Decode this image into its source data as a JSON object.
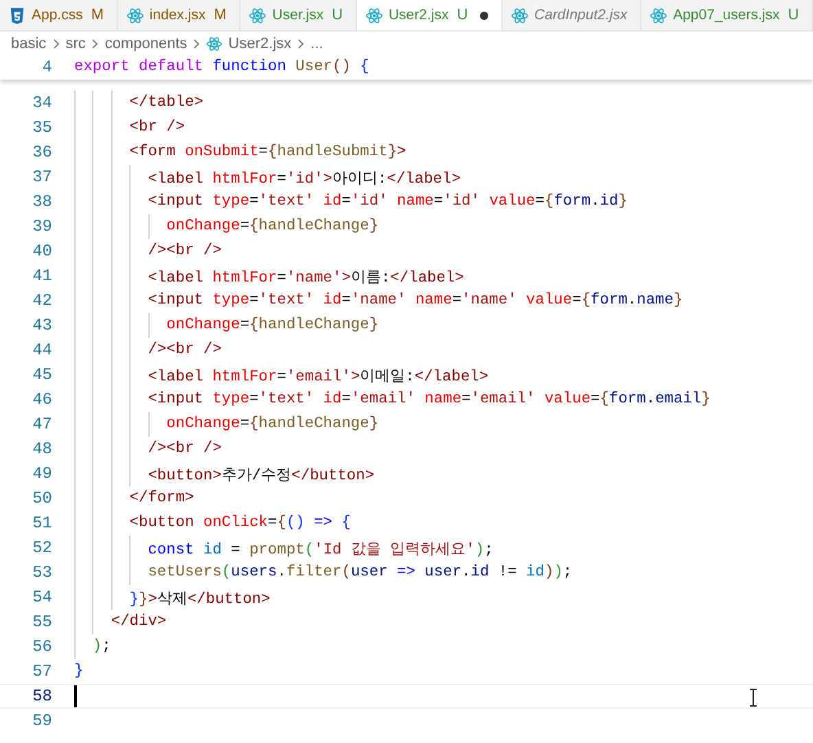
{
  "tabs": [
    {
      "label": "App.css",
      "kind": "css",
      "color": "#895503",
      "badge": "M",
      "selected": false,
      "dirty": false,
      "preview": false
    },
    {
      "label": "index.jsx",
      "kind": "react",
      "color": "#895503",
      "badge": "M",
      "selected": false,
      "dirty": false,
      "preview": false
    },
    {
      "label": "User.jsx",
      "kind": "react",
      "color": "#388a34",
      "badge": "U",
      "selected": false,
      "dirty": false,
      "preview": false
    },
    {
      "label": "User2.jsx",
      "kind": "react",
      "color": "#388a34",
      "badge": "U",
      "selected": true,
      "dirty": true,
      "preview": false
    },
    {
      "label": "CardInput2.jsx",
      "kind": "react",
      "color": "#777777",
      "selected": false,
      "dirty": false,
      "preview": true
    },
    {
      "label": "App07_users.jsx",
      "kind": "react",
      "color": "#388a34",
      "badge": "U",
      "selected": false,
      "dirty": false,
      "preview": false
    }
  ],
  "breadcrumb": [
    {
      "label": "basic",
      "kind": "folder"
    },
    {
      "label": "src",
      "kind": "folder"
    },
    {
      "label": "components",
      "kind": "folder"
    },
    {
      "label": "User2.jsx",
      "kind": "react"
    },
    {
      "label": "...",
      "kind": "more"
    }
  ],
  "sticky_line": {
    "number": "4",
    "tokens": [
      {
        "kind": "kw",
        "text": "export default "
      },
      {
        "kind": "kw2",
        "text": "function "
      },
      {
        "kind": "fn",
        "text": "User"
      },
      {
        "kind": "b3",
        "text": "() "
      },
      {
        "kind": "b1",
        "text": "{"
      }
    ]
  },
  "lines": [
    {
      "number": "34",
      "current": false,
      "tokens": [
        {
          "kind": "tag",
          "text": "      </table>"
        }
      ]
    },
    {
      "number": "35",
      "current": false,
      "tokens": [
        {
          "kind": "tag",
          "text": "      <br />"
        }
      ]
    },
    {
      "number": "36",
      "current": false,
      "tokens": [
        {
          "kind": "tag",
          "text": "      <form "
        },
        {
          "kind": "attr",
          "text": "onSubmit"
        },
        {
          "kind": "p",
          "text": "="
        },
        {
          "kind": "b3",
          "text": "{"
        },
        {
          "kind": "fn",
          "text": "handleSubmit"
        },
        {
          "kind": "b3",
          "text": "}"
        },
        {
          "kind": "tag",
          "text": ">"
        }
      ]
    },
    {
      "number": "37",
      "current": false,
      "tokens": [
        {
          "kind": "tag",
          "text": "        <label "
        },
        {
          "kind": "attr",
          "text": "htmlFor"
        },
        {
          "kind": "p",
          "text": "="
        },
        {
          "kind": "str",
          "text": "'id'"
        },
        {
          "kind": "tag",
          "text": ">"
        },
        {
          "kind": "p",
          "text": "아이디:"
        },
        {
          "kind": "tag",
          "text": "</label>"
        }
      ]
    },
    {
      "number": "38",
      "current": false,
      "tokens": [
        {
          "kind": "tag",
          "text": "        <input "
        },
        {
          "kind": "attr",
          "text": "type"
        },
        {
          "kind": "p",
          "text": "="
        },
        {
          "kind": "str",
          "text": "'text' "
        },
        {
          "kind": "attr",
          "text": "id"
        },
        {
          "kind": "p",
          "text": "="
        },
        {
          "kind": "str",
          "text": "'id' "
        },
        {
          "kind": "attr",
          "text": "name"
        },
        {
          "kind": "p",
          "text": "="
        },
        {
          "kind": "str",
          "text": "'id' "
        },
        {
          "kind": "attr",
          "text": "value"
        },
        {
          "kind": "p",
          "text": "="
        },
        {
          "kind": "b3",
          "text": "{"
        },
        {
          "kind": "var",
          "text": "form"
        },
        {
          "kind": "p",
          "text": "."
        },
        {
          "kind": "var",
          "text": "id"
        },
        {
          "kind": "b3",
          "text": "}"
        }
      ]
    },
    {
      "number": "39",
      "current": false,
      "tokens": [
        {
          "kind": "attr",
          "text": "          onChange"
        },
        {
          "kind": "p",
          "text": "="
        },
        {
          "kind": "b3",
          "text": "{"
        },
        {
          "kind": "fn",
          "text": "handleChange"
        },
        {
          "kind": "b3",
          "text": "}"
        }
      ]
    },
    {
      "number": "40",
      "current": false,
      "tokens": [
        {
          "kind": "tag",
          "text": "        /><br />"
        }
      ]
    },
    {
      "number": "41",
      "current": false,
      "tokens": [
        {
          "kind": "tag",
          "text": "        <label "
        },
        {
          "kind": "attr",
          "text": "htmlFor"
        },
        {
          "kind": "p",
          "text": "="
        },
        {
          "kind": "str",
          "text": "'name'"
        },
        {
          "kind": "tag",
          "text": ">"
        },
        {
          "kind": "p",
          "text": "이름:"
        },
        {
          "kind": "tag",
          "text": "</label>"
        }
      ]
    },
    {
      "number": "42",
      "current": false,
      "tokens": [
        {
          "kind": "tag",
          "text": "        <input "
        },
        {
          "kind": "attr",
          "text": "type"
        },
        {
          "kind": "p",
          "text": "="
        },
        {
          "kind": "str",
          "text": "'text' "
        },
        {
          "kind": "attr",
          "text": "id"
        },
        {
          "kind": "p",
          "text": "="
        },
        {
          "kind": "str",
          "text": "'name' "
        },
        {
          "kind": "attr",
          "text": "name"
        },
        {
          "kind": "p",
          "text": "="
        },
        {
          "kind": "str",
          "text": "'name' "
        },
        {
          "kind": "attr",
          "text": "value"
        },
        {
          "kind": "p",
          "text": "="
        },
        {
          "kind": "b3",
          "text": "{"
        },
        {
          "kind": "var",
          "text": "form"
        },
        {
          "kind": "p",
          "text": "."
        },
        {
          "kind": "var",
          "text": "name"
        },
        {
          "kind": "b3",
          "text": "}"
        }
      ]
    },
    {
      "number": "43",
      "current": false,
      "tokens": [
        {
          "kind": "attr",
          "text": "          onChange"
        },
        {
          "kind": "p",
          "text": "="
        },
        {
          "kind": "b3",
          "text": "{"
        },
        {
          "kind": "fn",
          "text": "handleChange"
        },
        {
          "kind": "b3",
          "text": "}"
        }
      ]
    },
    {
      "number": "44",
      "current": false,
      "tokens": [
        {
          "kind": "tag",
          "text": "        /><br />"
        }
      ]
    },
    {
      "number": "45",
      "current": false,
      "tokens": [
        {
          "kind": "tag",
          "text": "        <label "
        },
        {
          "kind": "attr",
          "text": "htmlFor"
        },
        {
          "kind": "p",
          "text": "="
        },
        {
          "kind": "str",
          "text": "'email'"
        },
        {
          "kind": "tag",
          "text": ">"
        },
        {
          "kind": "p",
          "text": "이메일:"
        },
        {
          "kind": "tag",
          "text": "</label>"
        }
      ]
    },
    {
      "number": "46",
      "current": false,
      "tokens": [
        {
          "kind": "tag",
          "text": "        <input "
        },
        {
          "kind": "attr",
          "text": "type"
        },
        {
          "kind": "p",
          "text": "="
        },
        {
          "kind": "str",
          "text": "'text' "
        },
        {
          "kind": "attr",
          "text": "id"
        },
        {
          "kind": "p",
          "text": "="
        },
        {
          "kind": "str",
          "text": "'email' "
        },
        {
          "kind": "attr",
          "text": "name"
        },
        {
          "kind": "p",
          "text": "="
        },
        {
          "kind": "str",
          "text": "'email' "
        },
        {
          "kind": "attr",
          "text": "value"
        },
        {
          "kind": "p",
          "text": "="
        },
        {
          "kind": "b3",
          "text": "{"
        },
        {
          "kind": "var",
          "text": "form"
        },
        {
          "kind": "p",
          "text": "."
        },
        {
          "kind": "var",
          "text": "email"
        },
        {
          "kind": "b3",
          "text": "}"
        }
      ]
    },
    {
      "number": "47",
      "current": false,
      "tokens": [
        {
          "kind": "attr",
          "text": "          onChange"
        },
        {
          "kind": "p",
          "text": "="
        },
        {
          "kind": "b3",
          "text": "{"
        },
        {
          "kind": "fn",
          "text": "handleChange"
        },
        {
          "kind": "b3",
          "text": "}"
        }
      ]
    },
    {
      "number": "48",
      "current": false,
      "tokens": [
        {
          "kind": "tag",
          "text": "        /><br />"
        }
      ]
    },
    {
      "number": "49",
      "current": false,
      "tokens": [
        {
          "kind": "tag",
          "text": "        <button>"
        },
        {
          "kind": "p",
          "text": "추가/수정"
        },
        {
          "kind": "tag",
          "text": "</button>"
        }
      ]
    },
    {
      "number": "50",
      "current": false,
      "tokens": [
        {
          "kind": "tag",
          "text": "      </form>"
        }
      ]
    },
    {
      "number": "51",
      "current": false,
      "tokens": [
        {
          "kind": "tag",
          "text": "      <button "
        },
        {
          "kind": "attr",
          "text": "onClick"
        },
        {
          "kind": "p",
          "text": "="
        },
        {
          "kind": "b3",
          "text": "{"
        },
        {
          "kind": "b1",
          "text": "() "
        },
        {
          "kind": "kw2",
          "text": "=> "
        },
        {
          "kind": "b1",
          "text": "{"
        }
      ]
    },
    {
      "number": "52",
      "current": false,
      "tokens": [
        {
          "kind": "kw2",
          "text": "        const "
        },
        {
          "kind": "cst",
          "text": "id"
        },
        {
          "kind": "p",
          "text": " = "
        },
        {
          "kind": "fn",
          "text": "prompt"
        },
        {
          "kind": "b2",
          "text": "("
        },
        {
          "kind": "str",
          "text": "'Id 값을 입력하세요'"
        },
        {
          "kind": "b2",
          "text": ")"
        },
        {
          "kind": "p",
          "text": ";"
        }
      ]
    },
    {
      "number": "53",
      "current": false,
      "tokens": [
        {
          "kind": "fn",
          "text": "        setUsers"
        },
        {
          "kind": "b2",
          "text": "("
        },
        {
          "kind": "var",
          "text": "users"
        },
        {
          "kind": "p",
          "text": "."
        },
        {
          "kind": "fn",
          "text": "filter"
        },
        {
          "kind": "b3",
          "text": "("
        },
        {
          "kind": "var",
          "text": "user"
        },
        {
          "kind": "kw2",
          "text": " => "
        },
        {
          "kind": "var",
          "text": "user"
        },
        {
          "kind": "p",
          "text": "."
        },
        {
          "kind": "var",
          "text": "id"
        },
        {
          "kind": "p",
          "text": " != "
        },
        {
          "kind": "cst",
          "text": "id"
        },
        {
          "kind": "b3",
          "text": ")"
        },
        {
          "kind": "b2",
          "text": ")"
        },
        {
          "kind": "p",
          "text": ";"
        }
      ]
    },
    {
      "number": "54",
      "current": false,
      "tokens": [
        {
          "kind": "b1",
          "text": "      }"
        },
        {
          "kind": "b3",
          "text": "}"
        },
        {
          "kind": "tag",
          "text": ">"
        },
        {
          "kind": "p",
          "text": "삭제"
        },
        {
          "kind": "tag",
          "text": "</button>"
        }
      ]
    },
    {
      "number": "55",
      "current": false,
      "tokens": [
        {
          "kind": "tag",
          "text": "    </div>"
        }
      ]
    },
    {
      "number": "56",
      "current": false,
      "tokens": [
        {
          "kind": "b2",
          "text": "  )"
        },
        {
          "kind": "p",
          "text": ";"
        }
      ]
    },
    {
      "number": "57",
      "current": false,
      "tokens": [
        {
          "kind": "b1",
          "text": "}"
        }
      ]
    },
    {
      "number": "58",
      "current": true
    },
    {
      "number": "59",
      "current": false
    }
  ]
}
